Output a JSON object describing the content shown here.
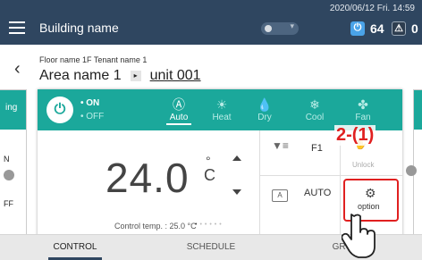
{
  "topbar": {
    "building": "Building name",
    "datetime": "2020/06/12 Fri. 14:59",
    "on_count": "64",
    "alert_count": "0"
  },
  "header": {
    "floor": "Floor name 1F Tenant name 1",
    "area": "Area name 1",
    "unit": "unit 001"
  },
  "left_card": {
    "label_top": "ing",
    "label_mid": "N",
    "label_bot": "FF"
  },
  "unit_card": {
    "on_label": "• ON",
    "off_label": "• OFF",
    "modes": [
      "Auto",
      "Heat",
      "Dry",
      "Cool",
      "Fan"
    ],
    "active_mode": "Auto",
    "setpoint": "24.0",
    "unit_symbol": "C",
    "degree": "°",
    "control_temp": "Control temp. : 25.0 °C",
    "fan_speed": "F1",
    "lock_label": "Unlock",
    "vane_label": "AUTO",
    "option_label": "option",
    "callout": "2-(1)"
  },
  "tabs": [
    "CONTROL",
    "SCHEDULE",
    "GROUP"
  ],
  "active_tab": "CONTROL",
  "colors": {
    "topbar": "#2f4660",
    "accent": "#1ba89b",
    "highlight": "#e02020"
  }
}
